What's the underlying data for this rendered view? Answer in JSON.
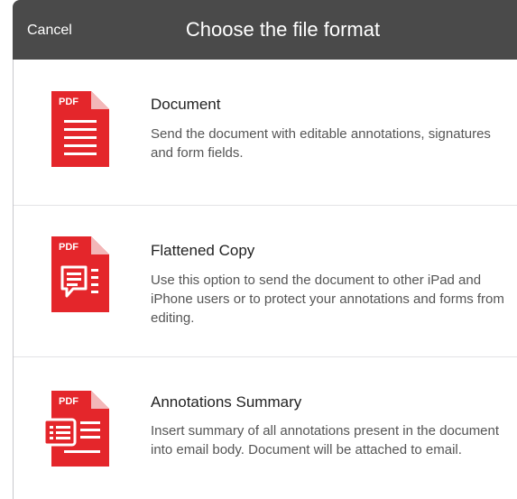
{
  "header": {
    "cancel_label": "Cancel",
    "title": "Choose the file format"
  },
  "options": [
    {
      "title": "Document",
      "description": "Send the document with editable annotations, signatures and form fields.",
      "icon_badge": "PDF",
      "icon": "pdf-document-icon"
    },
    {
      "title": "Flattened Copy",
      "description": "Use this option to send the document to other iPad and iPhone users or to protect your annotations and forms from editing.",
      "icon_badge": "PDF",
      "icon": "pdf-flattened-icon"
    },
    {
      "title": "Annotations Summary",
      "description": "Insert summary of all annotations present in the document into email body. Document will be attached to email.",
      "icon_badge": "PDF",
      "icon": "pdf-summary-icon"
    }
  ],
  "colors": {
    "header_bg": "#4a4a4a",
    "icon_red": "#e4262b",
    "icon_fold": "#f3b7b8"
  }
}
